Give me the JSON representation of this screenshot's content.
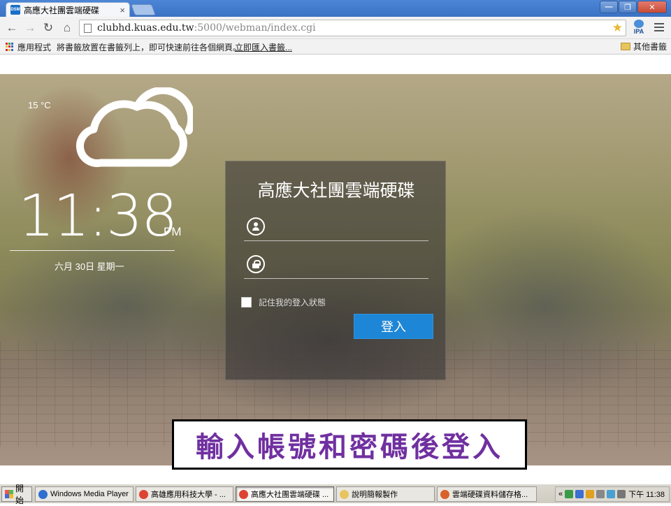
{
  "browser": {
    "tab": {
      "favicon_text": "DSM",
      "title": "高應大社團雲端硬碟",
      "close": "×"
    },
    "window_buttons": {
      "minimize": "—",
      "maximize": "❐",
      "close": "✕"
    },
    "nav": {
      "back": "←",
      "forward": "→",
      "reload": "↻",
      "home": "⌂"
    },
    "address": {
      "host": "clubhd.kuas.edu.tw",
      "path": ":5000/webman/index.cgi",
      "star": "★"
    },
    "extension": {
      "label": "IPA"
    },
    "bookmarks": {
      "apps": "應用程式",
      "hint": "將書籤放置在書籤列上，即可快速前往各個網頁。",
      "import": "立即匯入書籤...",
      "other": "其他書籤"
    }
  },
  "widget": {
    "temperature": "15 °C",
    "time": "11:38",
    "ampm": "PM",
    "date": "六月 30日 星期一"
  },
  "login": {
    "title": "高應大社團雲端硬碟",
    "username_placeholder": "",
    "password_placeholder": "",
    "remember_label": "記住我的登入狀態",
    "submit_label": "登入"
  },
  "caption": {
    "text": "輸入帳號和密碼後登入"
  },
  "taskbar": {
    "start": "開始",
    "tasks": [
      {
        "label": "Windows Media Player",
        "color": "#2f6fd0"
      },
      {
        "label": "高雄應用科技大學 - ...",
        "color": "#dd4433"
      },
      {
        "label": "高應大社團雲端硬碟 ...",
        "color": "#dd4433"
      },
      {
        "label": "說明簡報製作",
        "color": "#e8c460"
      },
      {
        "label": "雲端硬碟資料儲存格...",
        "color": "#d9622b"
      }
    ],
    "tray": {
      "arrow": "«",
      "clock": "下午 11:38"
    }
  }
}
